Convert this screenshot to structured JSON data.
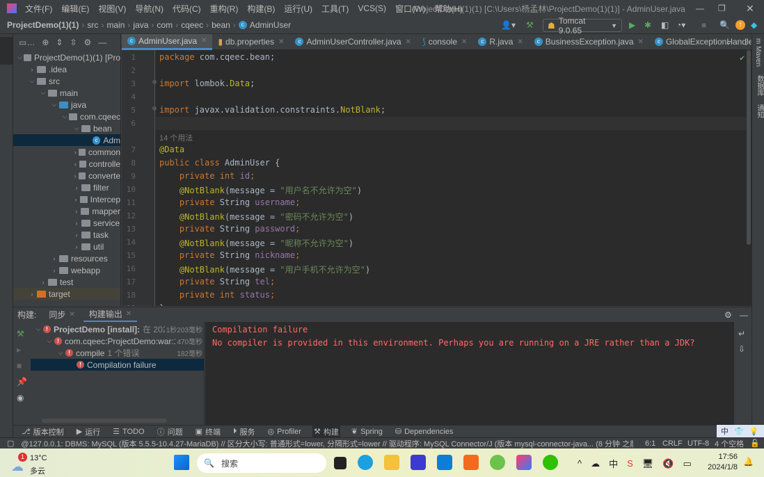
{
  "window": {
    "title": "ProjectDemo(1)(1) [C:\\Users\\杨孟林\\ProjectDemo(1)(1)] - AdminUser.java",
    "menu": [
      "文件(F)",
      "编辑(E)",
      "视图(V)",
      "导航(N)",
      "代码(C)",
      "重构(R)",
      "构建(B)",
      "运行(U)",
      "工具(T)",
      "VCS(S)",
      "窗口(W)",
      "帮助(H)"
    ]
  },
  "breadcrumb": [
    "ProjectDemo(1)(1)",
    "src",
    "main",
    "java",
    "com",
    "cqeec",
    "bean",
    "AdminUser"
  ],
  "toolbar": {
    "run_config": "Tomcat 9.0.65"
  },
  "project_tree": [
    {
      "label": "ProjectDemo(1)(1) [Pro",
      "indent": 0,
      "arrow": "v",
      "icon": "module"
    },
    {
      "label": ".idea",
      "indent": 1,
      "arrow": ">",
      "icon": "folder"
    },
    {
      "label": "src",
      "indent": 1,
      "arrow": "v",
      "icon": "folder"
    },
    {
      "label": "main",
      "indent": 2,
      "arrow": "v",
      "icon": "folder"
    },
    {
      "label": "java",
      "indent": 3,
      "arrow": "v",
      "icon": "source-folder"
    },
    {
      "label": "com.cqeec",
      "indent": 4,
      "arrow": "v",
      "icon": "package"
    },
    {
      "label": "bean",
      "indent": 5,
      "arrow": "v",
      "icon": "package"
    },
    {
      "label": "Adm",
      "indent": 6,
      "arrow": "",
      "icon": "class",
      "selected": true
    },
    {
      "label": "common",
      "indent": 5,
      "arrow": ">",
      "icon": "package"
    },
    {
      "label": "controlle",
      "indent": 5,
      "arrow": ">",
      "icon": "package"
    },
    {
      "label": "converte",
      "indent": 5,
      "arrow": ">",
      "icon": "package"
    },
    {
      "label": "filter",
      "indent": 5,
      "arrow": ">",
      "icon": "package"
    },
    {
      "label": "Intercep",
      "indent": 5,
      "arrow": ">",
      "icon": "package"
    },
    {
      "label": "mapper",
      "indent": 5,
      "arrow": ">",
      "icon": "package"
    },
    {
      "label": "service",
      "indent": 5,
      "arrow": ">",
      "icon": "package"
    },
    {
      "label": "task",
      "indent": 5,
      "arrow": ">",
      "icon": "package"
    },
    {
      "label": "util",
      "indent": 5,
      "arrow": ">",
      "icon": "package"
    },
    {
      "label": "resources",
      "indent": 3,
      "arrow": ">",
      "icon": "resources-folder"
    },
    {
      "label": "webapp",
      "indent": 3,
      "arrow": ">",
      "icon": "web-folder"
    },
    {
      "label": "test",
      "indent": 2,
      "arrow": ">",
      "icon": "folder"
    },
    {
      "label": "target",
      "indent": 1,
      "arrow": ">",
      "icon": "excluded-folder"
    }
  ],
  "tabs": [
    {
      "label": "AdminUser.java",
      "icon": "class",
      "active": true
    },
    {
      "label": "db.properties",
      "icon": "properties"
    },
    {
      "label": "AdminUserController.java",
      "icon": "class"
    },
    {
      "label": "console",
      "icon": "console"
    },
    {
      "label": "R.java",
      "icon": "class"
    },
    {
      "label": "BusinessException.java",
      "icon": "class"
    },
    {
      "label": "GlobalExceptionHandler.ja",
      "icon": "class"
    }
  ],
  "editor": {
    "usage_hint": "14 个用法",
    "lines": [
      {
        "n": "1",
        "parts": [
          [
            "kw",
            "package "
          ],
          [
            "",
            "com.cqeec.bean;"
          ]
        ]
      },
      {
        "n": "2",
        "parts": []
      },
      {
        "n": "3",
        "parts": [
          [
            "kw",
            "import "
          ],
          [
            "",
            "lombok."
          ],
          [
            "ann",
            "Data"
          ],
          [
            "",
            ";"
          ]
        ]
      },
      {
        "n": "4",
        "parts": []
      },
      {
        "n": "5",
        "parts": [
          [
            "kw",
            "import "
          ],
          [
            "",
            "javax.validation.constraints."
          ],
          [
            "ann",
            "NotBlank"
          ],
          [
            "",
            ";"
          ]
        ]
      },
      {
        "n": "6",
        "parts": []
      },
      {
        "n": "7",
        "parts": [
          [
            "ann",
            "@Data"
          ]
        ]
      },
      {
        "n": "8",
        "parts": [
          [
            "kw",
            "public class "
          ],
          [
            "",
            "AdminUser {"
          ]
        ]
      },
      {
        "n": "9",
        "parts": [
          [
            "",
            "    "
          ],
          [
            "kw",
            "private int "
          ],
          [
            "fld",
            "id"
          ],
          [
            "kw",
            ";"
          ]
        ]
      },
      {
        "n": "10",
        "parts": [
          [
            "",
            "    "
          ],
          [
            "ann",
            "@NotBlank"
          ],
          [
            "",
            "(message = "
          ],
          [
            "str",
            "\"用户名不允许为空\""
          ],
          [
            "",
            ")"
          ]
        ]
      },
      {
        "n": "11",
        "parts": [
          [
            "",
            "    "
          ],
          [
            "kw",
            "private "
          ],
          [
            "",
            "String "
          ],
          [
            "fld",
            "username"
          ],
          [
            "kw",
            ";"
          ]
        ]
      },
      {
        "n": "12",
        "parts": [
          [
            "",
            "    "
          ],
          [
            "ann",
            "@NotBlank"
          ],
          [
            "",
            "(message = "
          ],
          [
            "str",
            "\"密码不允许为空\""
          ],
          [
            "",
            ")"
          ]
        ]
      },
      {
        "n": "13",
        "parts": [
          [
            "",
            "    "
          ],
          [
            "kw",
            "private "
          ],
          [
            "",
            "String "
          ],
          [
            "fld",
            "password"
          ],
          [
            "kw",
            ";"
          ]
        ]
      },
      {
        "n": "14",
        "parts": [
          [
            "",
            "    "
          ],
          [
            "ann",
            "@NotBlank"
          ],
          [
            "",
            "(message = "
          ],
          [
            "str",
            "\"昵称不允许为空\""
          ],
          [
            "",
            ")"
          ]
        ]
      },
      {
        "n": "15",
        "parts": [
          [
            "",
            "    "
          ],
          [
            "kw",
            "private "
          ],
          [
            "",
            "String "
          ],
          [
            "fld",
            "nickname"
          ],
          [
            "kw",
            ";"
          ]
        ]
      },
      {
        "n": "16",
        "parts": [
          [
            "",
            "    "
          ],
          [
            "ann",
            "@NotBlank"
          ],
          [
            "",
            "(message = "
          ],
          [
            "str",
            "\"用户手机不允许为空\""
          ],
          [
            "",
            ")"
          ]
        ]
      },
      {
        "n": "17",
        "parts": [
          [
            "",
            "    "
          ],
          [
            "kw",
            "private "
          ],
          [
            "",
            "String "
          ],
          [
            "fld",
            "tel"
          ],
          [
            "kw",
            ";"
          ]
        ]
      },
      {
        "n": "18",
        "parts": [
          [
            "",
            "    "
          ],
          [
            "kw",
            "private int "
          ],
          [
            "fld",
            "status"
          ],
          [
            "kw",
            ";"
          ]
        ]
      },
      {
        "n": "19",
        "parts": [
          [
            "",
            "}"
          ]
        ]
      }
    ]
  },
  "build": {
    "label": "构建:",
    "tabs": [
      {
        "label": "同步"
      },
      {
        "label": "构建输出",
        "active": true
      }
    ],
    "tree": [
      {
        "label": "ProjectDemo [install]:",
        "extra": "在 2024/",
        "time": "1秒203毫秒",
        "indent": 0,
        "bold": true
      },
      {
        "label": "com.cqeec:ProjectDemo:war:1.0-",
        "extra": "",
        "time": "470毫秒",
        "indent": 1
      },
      {
        "label": "compile",
        "extra": "1 个错误",
        "time": "182毫秒",
        "indent": 2
      },
      {
        "label": "Compilation failure",
        "extra": "",
        "time": "",
        "indent": 3,
        "selected": true
      }
    ],
    "output": [
      "Compilation failure",
      "No compiler is provided in this environment. Perhaps you are running on a JRE rather than a JDK?"
    ]
  },
  "tool_tabs": [
    "版本控制",
    "运行",
    "TODO",
    "问题",
    "终端",
    "服务",
    "Profiler",
    "构建",
    "Spring",
    "Dependencies"
  ],
  "status": {
    "message": "@127.0.0.1: DBMS: MySQL (版本 5.5.5-10.4.27-MariaDB) // 区分大小写: 普通形式=lower, 分隔形式=lower // 驱动程序: MySQL Connector/J (版本 mysql-connector-java... (8 分钟 之前)",
    "position": "6:1",
    "line_sep": "CRLF",
    "encoding": "UTF-8",
    "indent": "4 个空格",
    "ime": "中"
  },
  "taskbar": {
    "weather_temp": "13°C",
    "weather_desc": "多云",
    "weather_badge": "1",
    "search_placeholder": "搜索",
    "time": "17:56",
    "date": "2024/1/8",
    "tray_ime": "中"
  },
  "colors": {
    "accent": "#4a88c7",
    "error": "#ff6b68",
    "keyword": "#cc7832",
    "annotation": "#bbb529",
    "string": "#6a8759",
    "field": "#9876aa"
  }
}
